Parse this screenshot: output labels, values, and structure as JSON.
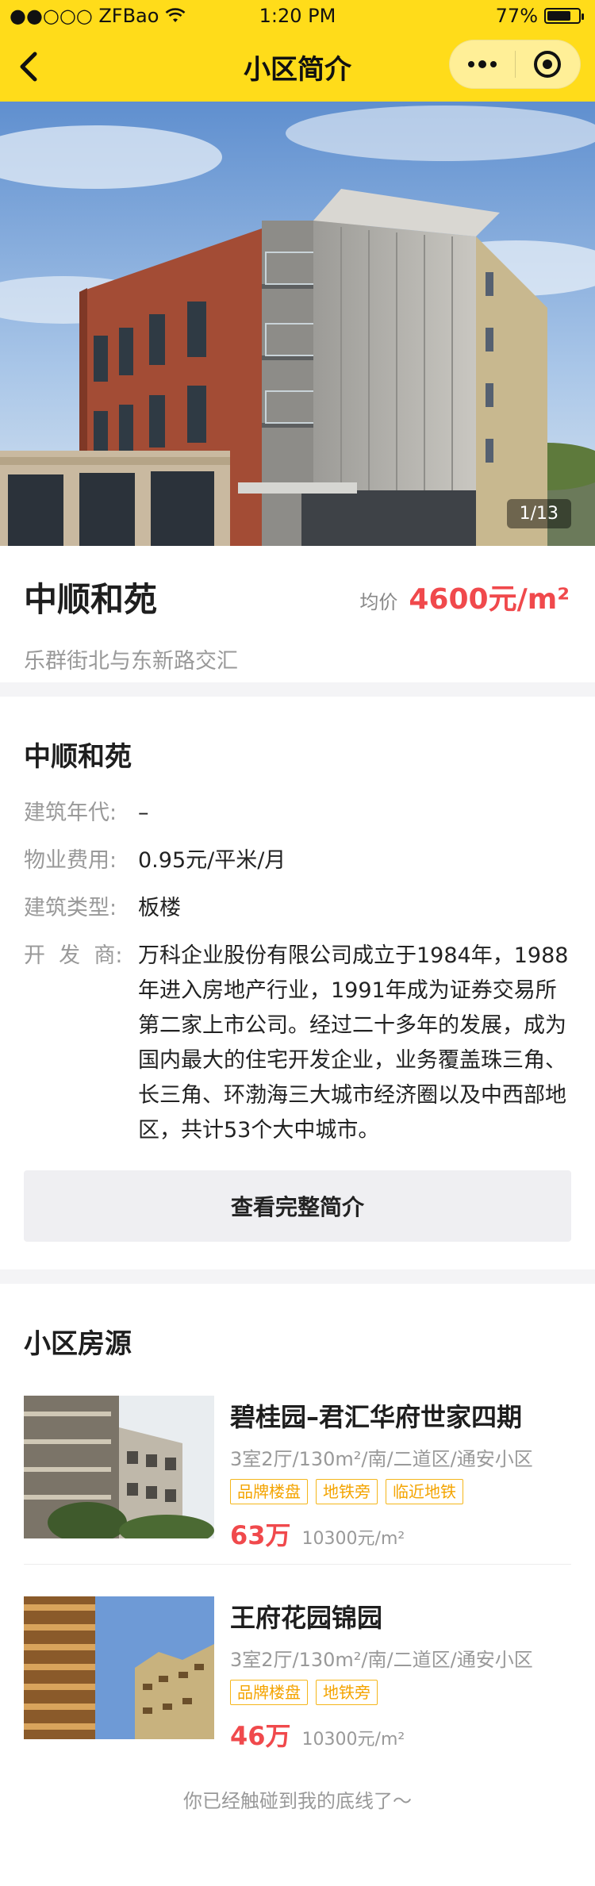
{
  "status_bar": {
    "carrier": "●●○○○ ZFBao",
    "time": "1:20 PM",
    "battery": "77%",
    "battery_level": 0.77
  },
  "nav": {
    "title": "小区简介"
  },
  "hero": {
    "counter": "1/13"
  },
  "estate": {
    "name": "中顺和苑",
    "price_label": "均价",
    "price": "4600元/m²",
    "address": "乐群街北与东新路交汇"
  },
  "intro": {
    "title": "中顺和苑",
    "rows": [
      {
        "key": "建筑年代:",
        "value": "–"
      },
      {
        "key": "物业费用:",
        "value": "0.95元/平米/月"
      },
      {
        "key": "建筑类型:",
        "value": "板楼"
      },
      {
        "key": "开  发  商:",
        "value": "万科企业股份有限公司成立于1984年，1988年进入房地产行业，1991年成为证券交易所第二家上市公司。经过二十多年的发展，成为国内最大的住宅开发企业，业务覆盖珠三角、长三角、环渤海三大城市经济圈以及中西部地区，共计53个大中城市。"
      }
    ],
    "button": "查看完整简介"
  },
  "listings": {
    "title": "小区房源",
    "items": [
      {
        "title": "碧桂园–君汇华府世家四期",
        "desc": "3室2厅/130m²/南/二道区/通安小区",
        "tags": [
          "品牌楼盘",
          "地铁旁",
          "临近地铁"
        ],
        "price": "63万",
        "unit_price": "10300元/m²"
      },
      {
        "title": "王府花园锦园",
        "desc": "3室2厅/130m²/南/二道区/通安小区",
        "tags": [
          "品牌楼盘",
          "地铁旁"
        ],
        "price": "46万",
        "unit_price": "10300元/m²"
      }
    ]
  },
  "footer": {
    "note": "你已经触碰到我的底线了～"
  },
  "colors": {
    "brand_yellow": "#ffdc1a",
    "price_red": "#f0494c",
    "tag_orange": "#f4a400"
  }
}
